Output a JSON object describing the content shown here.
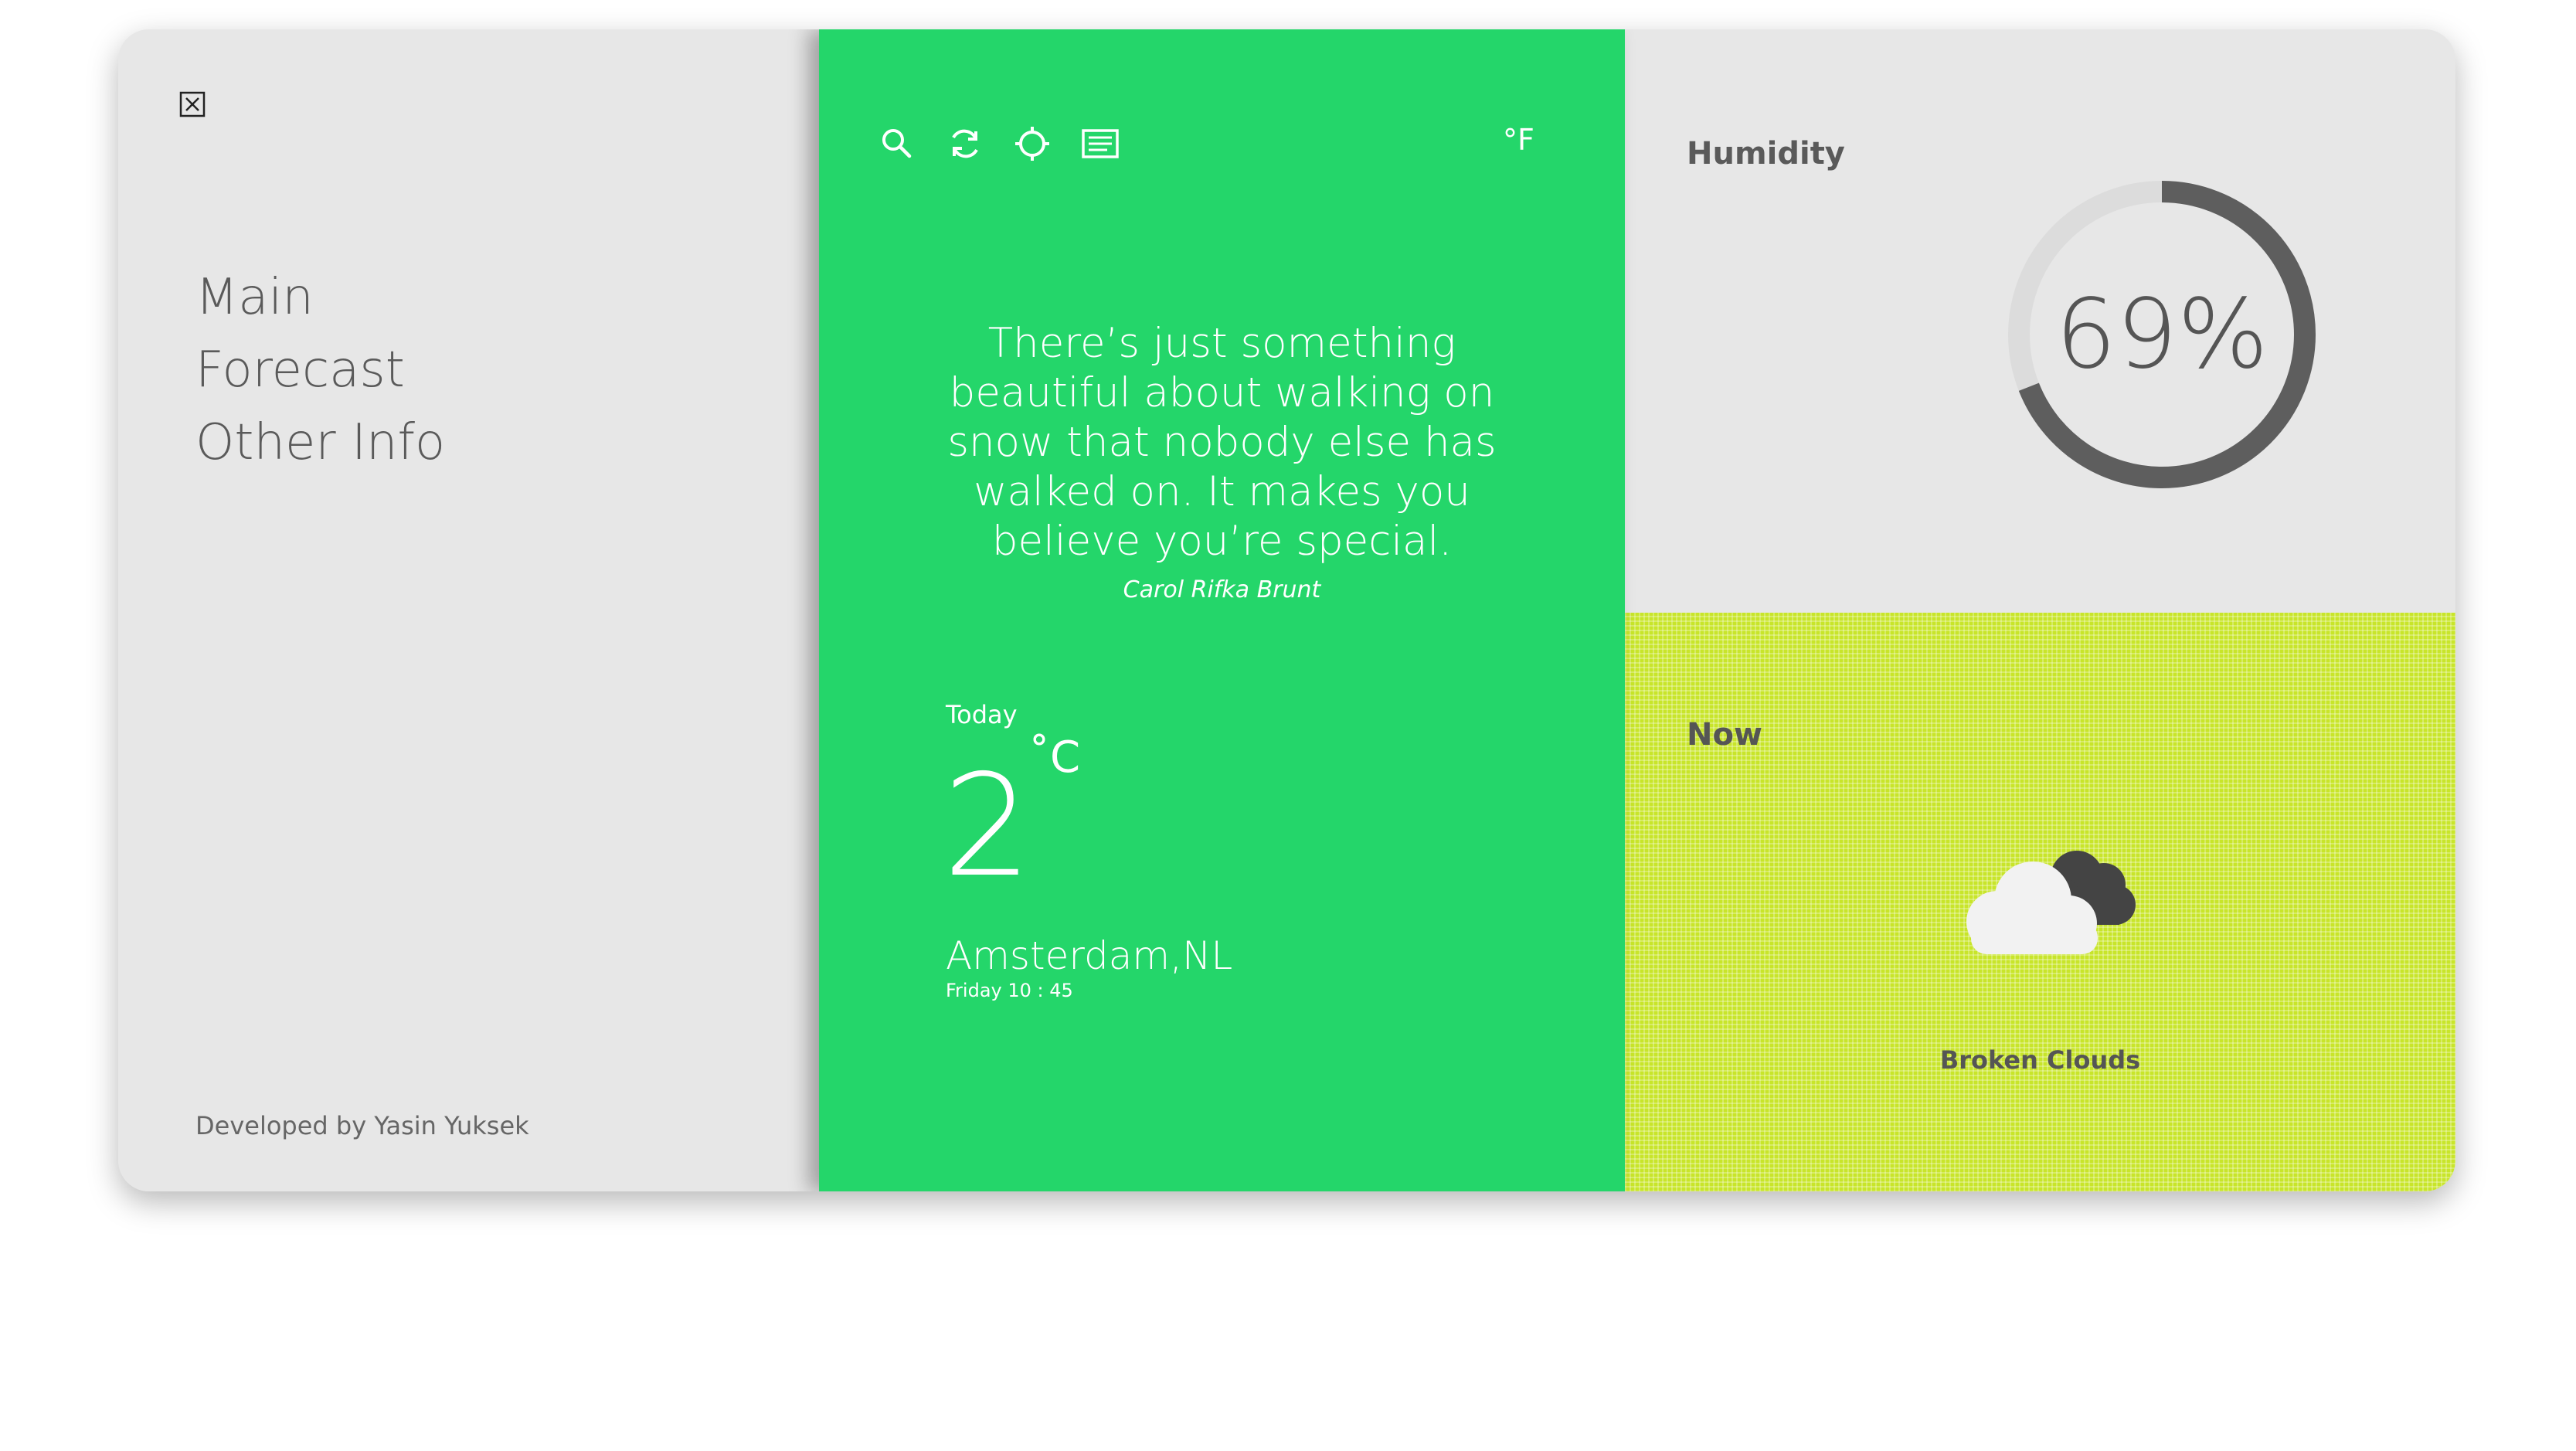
{
  "sidebar": {
    "close_icon": "close-icon",
    "menu": [
      {
        "label": "Main"
      },
      {
        "label": "Forecast"
      },
      {
        "label": "Other Info"
      }
    ],
    "credits": "Developed by Yasin Yuksek"
  },
  "toolbar": {
    "icons": [
      "search-icon",
      "refresh-icon",
      "locate-icon",
      "list-icon"
    ],
    "unit_toggle": "°F"
  },
  "quote": {
    "text": "There’s just something beautiful about walking on snow that nobody else has walked on. It makes you believe you’re special.",
    "author": "Carol Rifka Brunt"
  },
  "today": {
    "label": "Today",
    "temperature": "2",
    "unit": "˚C",
    "city": "Amsterdam,NL",
    "datetime": "Friday 10 : 45"
  },
  "humidity": {
    "title": "Humidity",
    "value": 69,
    "display": "69%"
  },
  "now": {
    "title": "Now",
    "icon": "broken-clouds-icon",
    "condition": "Broken Clouds"
  },
  "colors": {
    "main_green": "#24d66a",
    "lime_panel": "#c8e52a",
    "panel_gray": "#e7e7e7",
    "text_gray": "#5a5a5a"
  }
}
